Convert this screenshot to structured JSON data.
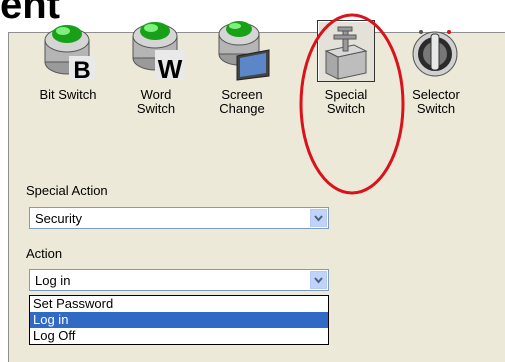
{
  "heading": "ent",
  "toolbar": {
    "items": [
      {
        "label_line1": "Bit Switch",
        "label_line2": ""
      },
      {
        "label_line1": "Word",
        "label_line2": "Switch"
      },
      {
        "label_line1": "Screen",
        "label_line2": "Change"
      },
      {
        "label_line1": "Special",
        "label_line2": "Switch"
      },
      {
        "label_line1": "Selector",
        "label_line2": "Switch"
      }
    ],
    "selected_index": 3,
    "letters": {
      "bit": "B",
      "word": "W"
    }
  },
  "special_action": {
    "label": "Special Action",
    "value": "Security"
  },
  "action": {
    "label": "Action",
    "value": "Log in",
    "options": [
      "Set Password",
      "Log in",
      "Log Off"
    ],
    "highlighted_index": 1
  },
  "colors": {
    "annotation": "#d9121b",
    "selection": "#316ac5"
  }
}
